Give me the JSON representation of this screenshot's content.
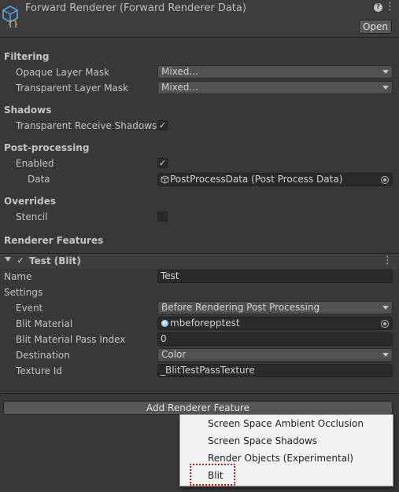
{
  "header": {
    "title": "Forward Renderer (Forward Renderer Data)",
    "open_label": "Open",
    "help_glyph": "?",
    "kebab_glyph": "⋮",
    "asset_icon": "renderer-data-asset-icon"
  },
  "filtering": {
    "title": "Filtering",
    "opaque_label": "Opaque Layer Mask",
    "opaque_value": "Mixed...",
    "transparent_label": "Transparent Layer Mask",
    "transparent_value": "Mixed..."
  },
  "shadows": {
    "title": "Shadows",
    "receive_label": "Transparent Receive Shadows",
    "receive_checked": true
  },
  "post_processing": {
    "title": "Post-processing",
    "enabled_label": "Enabled",
    "enabled_checked": true,
    "data_label": "Data",
    "data_value": "PostProcessData (Post Process Data)"
  },
  "overrides": {
    "title": "Overrides",
    "stencil_label": "Stencil",
    "stencil_checked": false
  },
  "renderer_features": {
    "title": "Renderer Features"
  },
  "feature": {
    "header_label": "Test (Blit)",
    "enabled": true,
    "name_label": "Name",
    "name_value": "Test",
    "settings_label": "Settings",
    "event_label": "Event",
    "event_value": "Before Rendering Post Processing",
    "blit_material_label": "Blit Material",
    "blit_material_value": "mbeforepptest",
    "pass_index_label": "Blit Material Pass Index",
    "pass_index_value": "0",
    "destination_label": "Destination",
    "destination_value": "Color",
    "texture_id_label": "Texture Id",
    "texture_id_value": "_BlitTestPassTexture"
  },
  "add_feature": {
    "label": "Add Renderer Feature"
  },
  "popup_menu": {
    "items": [
      "Screen Space Ambient Occlusion",
      "Screen Space Shadows",
      "Render Objects (Experimental)",
      "Blit"
    ],
    "highlighted_item": "Blit",
    "highlight_color": "#cc1f1f"
  },
  "colors": {
    "background": "#383838",
    "field_background": "#2a2a2a",
    "dropdown_background": "#515151",
    "asset_icon_accent": "#e8a33c",
    "asset_icon_blue": "#5aa8e8"
  }
}
